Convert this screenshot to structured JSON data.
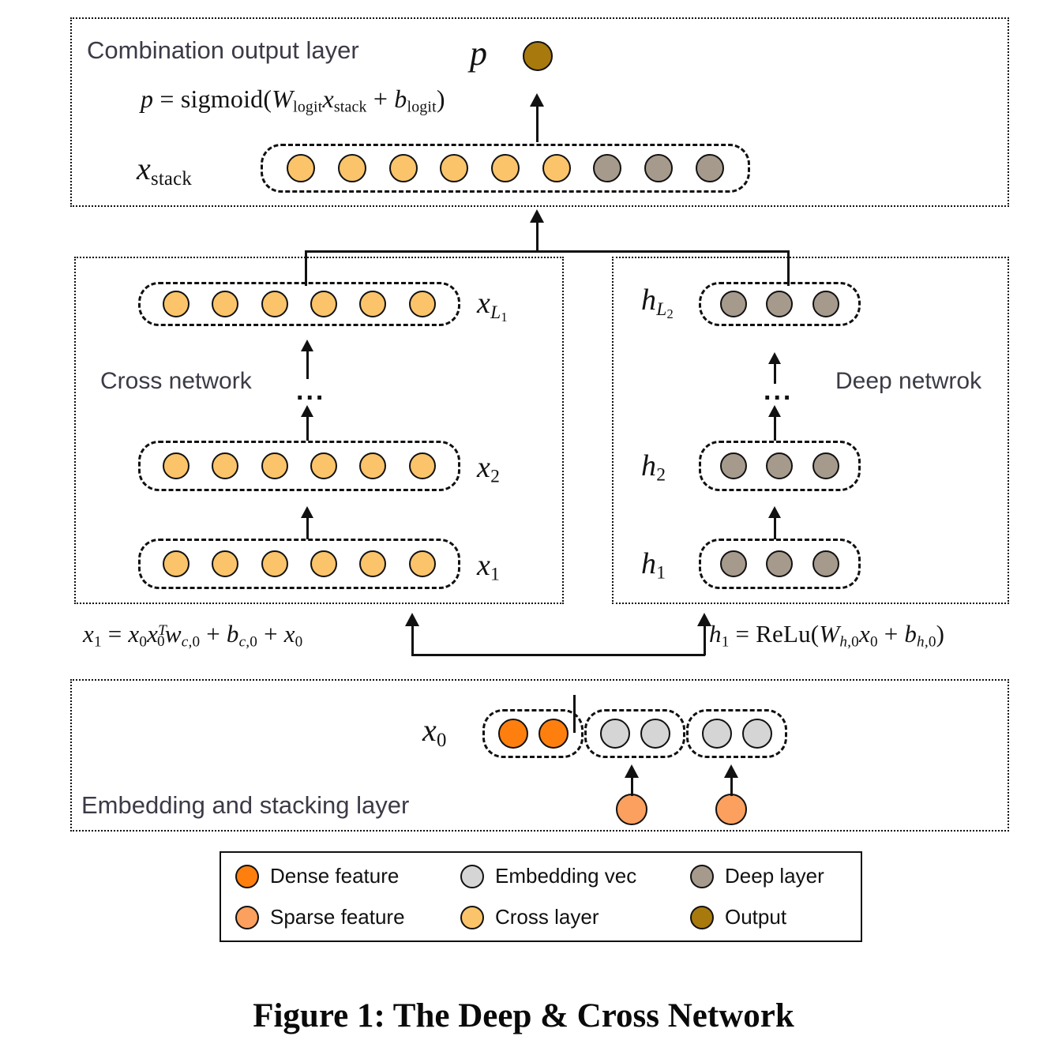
{
  "figure": {
    "caption": "Figure 1: The Deep & Cross Network"
  },
  "colors": {
    "dense_feature": "#FF7F0E",
    "sparse_feature": "#FBA05E",
    "embedding_vec": "#D5D5D5",
    "cross_layer": "#FBC46A",
    "deep_layer": "#A59A8C",
    "output": "#A8790D",
    "outline": "#111111",
    "label_text": "#3b3b47"
  },
  "sections": {
    "combination_output": {
      "title": "Combination output layer",
      "output_label": "p",
      "formula": "p = sigmoid(W_logit x_stack + b_logit)",
      "stack_label": "x_stack",
      "stack_nodes": [
        "cross_layer",
        "cross_layer",
        "cross_layer",
        "cross_layer",
        "cross_layer",
        "cross_layer",
        "deep_layer",
        "deep_layer",
        "deep_layer"
      ]
    },
    "cross_network": {
      "title": "Cross network",
      "ellipsis": "...",
      "layers": [
        {
          "label": "x_L1",
          "node_count": 6,
          "node_type": "cross_layer"
        },
        {
          "label": "x_2",
          "node_count": 6,
          "node_type": "cross_layer"
        },
        {
          "label": "x_1",
          "node_count": 6,
          "node_type": "cross_layer"
        }
      ],
      "formula": "x_1 = x_0 x_0^T w_c,0 + b_c,0 + x_0"
    },
    "deep_network": {
      "title": "Deep netwrok",
      "ellipsis": "...",
      "layers": [
        {
          "label": "h_L2",
          "node_count": 3,
          "node_type": "deep_layer"
        },
        {
          "label": "h_2",
          "node_count": 3,
          "node_type": "deep_layer"
        },
        {
          "label": "h_1",
          "node_count": 3,
          "node_type": "deep_layer"
        }
      ],
      "formula": "h_1 = ReLu(W_h,0 x_0 + b_h,0)"
    },
    "embedding_stacking": {
      "title": "Embedding and stacking layer",
      "input_label": "x_0",
      "groups": [
        {
          "node_count": 2,
          "node_type": "dense_feature"
        },
        {
          "node_count": 2,
          "node_type": "embedding_vec"
        },
        {
          "node_count": 2,
          "node_type": "embedding_vec"
        }
      ],
      "sparse_inputs": [
        {
          "node_type": "sparse_feature"
        },
        {
          "node_type": "sparse_feature"
        }
      ]
    }
  },
  "legend": {
    "items": [
      {
        "label": "Dense feature",
        "color_key": "dense_feature"
      },
      {
        "label": "Embedding vec",
        "color_key": "embedding_vec"
      },
      {
        "label": "Deep layer",
        "color_key": "deep_layer"
      },
      {
        "label": "Sparse feature",
        "color_key": "sparse_feature"
      },
      {
        "label": "Cross layer",
        "color_key": "cross_layer"
      },
      {
        "label": "Output",
        "color_key": "output"
      }
    ]
  }
}
